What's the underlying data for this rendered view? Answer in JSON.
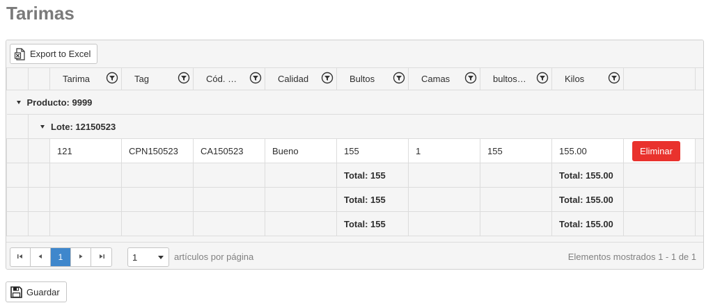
{
  "page_title": "Tarimas",
  "toolbar": {
    "export_label": "Export to Excel"
  },
  "columns": [
    "Tarima",
    "Tag",
    "Cód. …",
    "Calidad",
    "Bultos",
    "Camas",
    "bultos…",
    "Kilos"
  ],
  "group_product": "Producto: 9999",
  "group_lote": "Lote: 12150523",
  "row": {
    "tarima": "121",
    "tag": "CPN150523",
    "cod": "CA150523",
    "calidad": "Bueno",
    "bultos": "155",
    "camas": "1",
    "bultos2": "155",
    "kilos": "155.00",
    "delete_label": "Eliminar"
  },
  "footers": {
    "lote": {
      "bultos": "Total: 155",
      "kilos": "Total: 155.00"
    },
    "producto": {
      "bultos": "Total: 155",
      "kilos": "Total: 155.00"
    },
    "grand": {
      "bultos": "Total: 155",
      "kilos": "Total: 155.00"
    }
  },
  "pager": {
    "current_page": "1",
    "page_size": "1",
    "page_size_label": "artículos por página",
    "info": "Elementos mostrados 1 - 1 de 1"
  },
  "save_label": "Guardar",
  "colors": {
    "accent": "#3f87cc",
    "danger": "#e9322d",
    "title": "#7a7a7a"
  }
}
